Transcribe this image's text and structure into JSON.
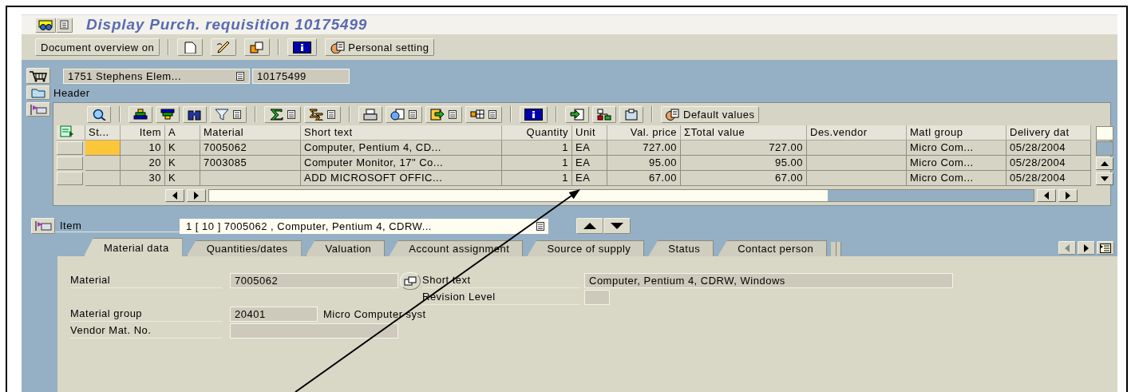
{
  "window": {
    "title": "Display Purch. requisition 10175499"
  },
  "toolbar": [
    {
      "buttons": [
        {
          "kind": "text",
          "label": "Document overview on"
        }
      ]
    },
    {
      "buttons": [
        {
          "kind": "icon"
        },
        {
          "kind": "icon"
        },
        {
          "kind": "icon"
        }
      ]
    },
    {
      "buttons": [
        {
          "kind": "icon"
        },
        {
          "kind": "icon-text",
          "label": "Personal setting"
        }
      ]
    }
  ],
  "header": {
    "org": "1751 Stephens Elem...",
    "number": "10175499",
    "section": "Header"
  },
  "table": {
    "toolbar": [
      {
        "buttons": [
          {
            "kind": "icon"
          }
        ]
      },
      {
        "buttons": [
          {
            "kind": "icon"
          },
          {
            "kind": "icon"
          },
          {
            "kind": "icon"
          },
          {
            "kind": "icon-menu"
          }
        ]
      },
      {
        "buttons": [
          {
            "kind": "icon-menu"
          },
          {
            "kind": "icon-menu"
          }
        ]
      },
      {
        "buttons": [
          {
            "kind": "icon"
          },
          {
            "kind": "icon-menu"
          },
          {
            "kind": "icon-menu"
          },
          {
            "kind": "icon-menu"
          }
        ]
      },
      {
        "buttons": [
          {
            "kind": "icon"
          }
        ]
      },
      {
        "buttons": [
          {
            "kind": "icon"
          },
          {
            "kind": "icon"
          },
          {
            "kind": "icon"
          }
        ]
      },
      {
        "buttons": [
          {
            "kind": "icon-text",
            "label": "Default values"
          }
        ]
      }
    ],
    "columns": [
      {
        "label": "St..."
      },
      {
        "label": "Item"
      },
      {
        "label": "A"
      },
      {
        "label": "Material"
      },
      {
        "label": "Short text"
      },
      {
        "label": "Quantity"
      },
      {
        "label": "Unit"
      },
      {
        "label": "Val. price"
      },
      {
        "label": "Total value",
        "prefix": "Σ"
      },
      {
        "label": "Des.vendor"
      },
      {
        "label": "Matl group"
      },
      {
        "label": "Delivery dat"
      }
    ],
    "rows": [
      {
        "current": true,
        "item": "10",
        "a": "K",
        "material": "7005062",
        "short_text": "Computer, Pentium 4, CD...",
        "quantity": "1",
        "unit": "EA",
        "val_price": "727.00",
        "total_value": "727.00",
        "matl_group": "Micro Com...",
        "delivery": "05/28/2004"
      },
      {
        "current": false,
        "item": "20",
        "a": "K",
        "material": "7003085",
        "short_text": "Computer Monitor, 17\" Co...",
        "quantity": "1",
        "unit": "EA",
        "val_price": "95.00",
        "total_value": "95.00",
        "matl_group": "Micro Com...",
        "delivery": "05/28/2004"
      },
      {
        "current": false,
        "item": "30",
        "a": "K",
        "short_text": "ADD MICROSOFT OFFIC...",
        "quantity": "1",
        "unit": "EA",
        "val_price": "67.00",
        "total_value": "67.00",
        "matl_group": "Micro Com...",
        "delivery": "05/28/2004"
      }
    ]
  },
  "item": {
    "label": "Item",
    "selector": "1 [ 10 ] 7005062 , Computer, Pentium 4, CDRW...",
    "tabs": [
      {
        "label": "Material data",
        "selected": true
      },
      {
        "label": "Quantities/dates",
        "selected": false
      },
      {
        "label": "Valuation",
        "selected": false
      },
      {
        "label": "Account assignment",
        "selected": false
      },
      {
        "label": "Source of supply",
        "selected": false
      },
      {
        "label": "Status",
        "selected": false
      },
      {
        "label": "Contact person",
        "selected": false
      }
    ],
    "form": {
      "material": {
        "label": "Material",
        "value": "7005062"
      },
      "short_text": {
        "label": "Short text",
        "value": "Computer, Pentium 4, CDRW, Windows"
      },
      "revision_level": {
        "label": "Revision Level"
      },
      "material_group": {
        "label": "Material group",
        "value": "20401",
        "description": "Micro Computer syst"
      },
      "vendor_mat_no": {
        "label": "Vendor Mat. No."
      }
    }
  }
}
